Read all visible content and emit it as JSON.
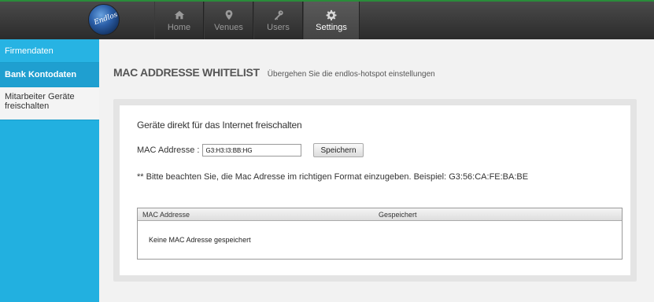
{
  "logo": {
    "text": "Endlos"
  },
  "nav": [
    {
      "label": "Home",
      "icon": "home-icon"
    },
    {
      "label": "Venues",
      "icon": "map-pin-icon"
    },
    {
      "label": "Users",
      "icon": "key-icon"
    },
    {
      "label": "Settings",
      "icon": "gear-icon",
      "active": true
    }
  ],
  "sidebar": {
    "items": [
      {
        "label": "Firmendaten"
      },
      {
        "label": "Bank Kontodaten",
        "active": true
      },
      {
        "label": "Mitarbeiter Geräte freischalten"
      }
    ]
  },
  "page": {
    "title": "MAC ADDRESSE WHITELIST",
    "subtitle": "Übergehen Sie die endlos-hotspot einstellungen"
  },
  "panel": {
    "title": "Geräte direkt für das Internet freischalten",
    "mac_label": "MAC Addresse :",
    "mac_value": "G3:H3:I3:BB:HG",
    "save_label": "Speichern",
    "hint": "** Bitte beachten Sie, die Mac Adresse im richtigen Format einzugeben. Beispiel: G3:56:CA:FE:BA:BE"
  },
  "table": {
    "columns": [
      "MAC Addresse",
      "Gespeichert"
    ],
    "empty_text": "Keine MAC Adresse gespeichert"
  },
  "colors": {
    "sidebar_blue": "#22b0e0",
    "topbar_dark": "#2b2b2b",
    "accent_green": "#2a8c3a"
  }
}
